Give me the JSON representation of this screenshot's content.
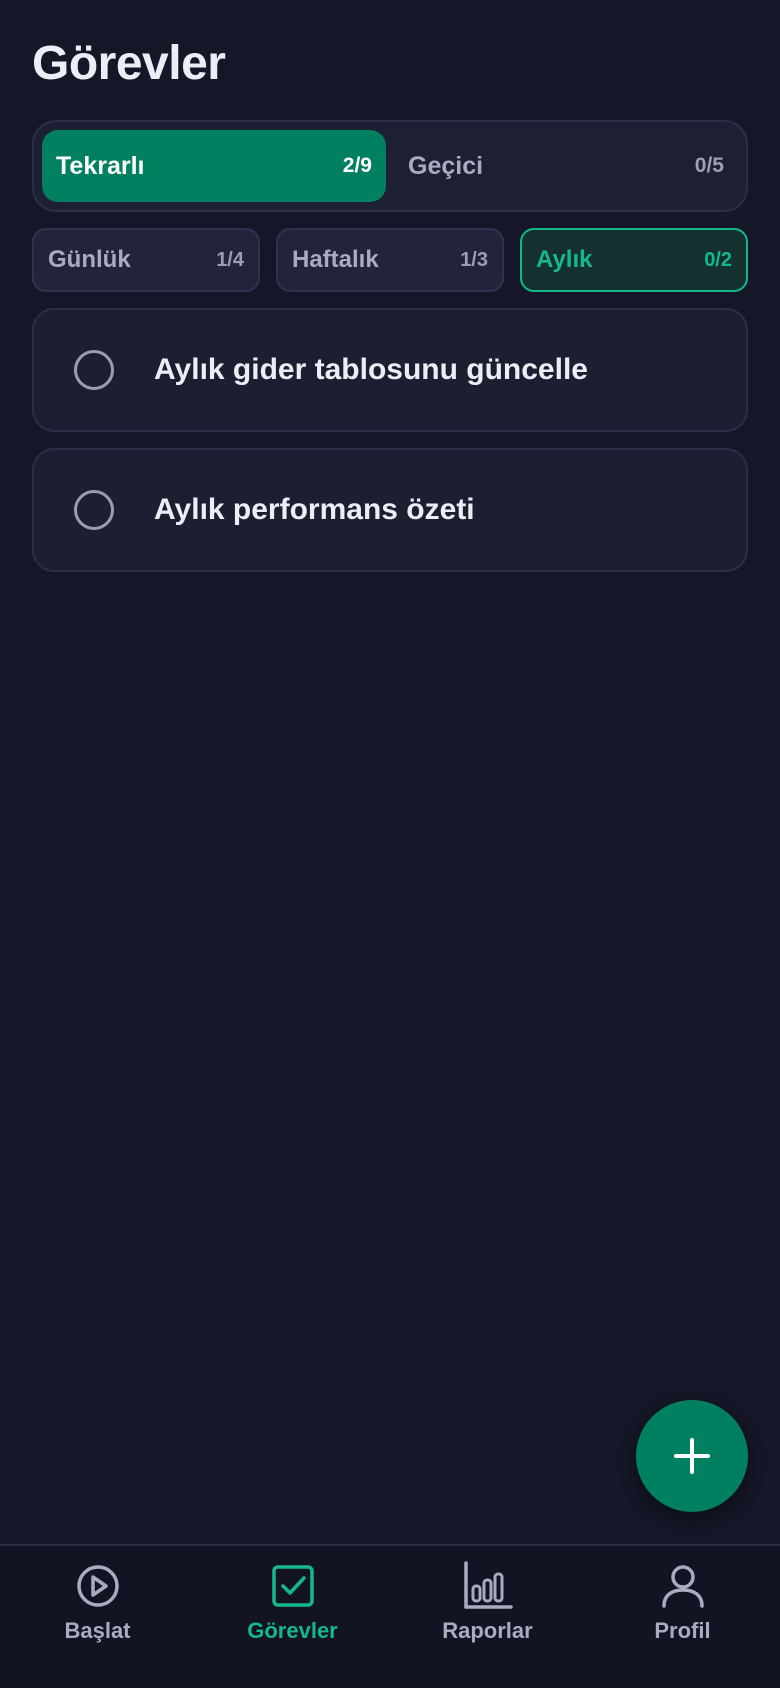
{
  "header": {
    "title": "Görevler"
  },
  "main_tabs": [
    {
      "label": "Tekrarlı",
      "count": "2/9",
      "active": true
    },
    {
      "label": "Geçici",
      "count": "0/5",
      "active": false
    }
  ],
  "sub_tabs": [
    {
      "label": "Günlük",
      "count": "1/4",
      "active": false
    },
    {
      "label": "Haftalık",
      "count": "1/3",
      "active": false
    },
    {
      "label": "Aylık",
      "count": "0/2",
      "active": true
    }
  ],
  "tasks": [
    {
      "title": "Aylık gider tablosunu güncelle",
      "done": false
    },
    {
      "title": "Aylık performans özeti",
      "done": false
    }
  ],
  "fab": {
    "icon": "plus-icon"
  },
  "bottom_nav": [
    {
      "label": "Başlat",
      "icon": "play-circle-icon",
      "active": false
    },
    {
      "label": "Görevler",
      "icon": "checkbox-icon",
      "active": true
    },
    {
      "label": "Raporlar",
      "icon": "bar-chart-icon",
      "active": false
    },
    {
      "label": "Profil",
      "icon": "user-icon",
      "active": false
    }
  ],
  "colors": {
    "background": "#151728",
    "accent": "#008060",
    "accent_text": "#14b88a",
    "card": "#1c1e32",
    "muted_text": "#a9acc0"
  }
}
